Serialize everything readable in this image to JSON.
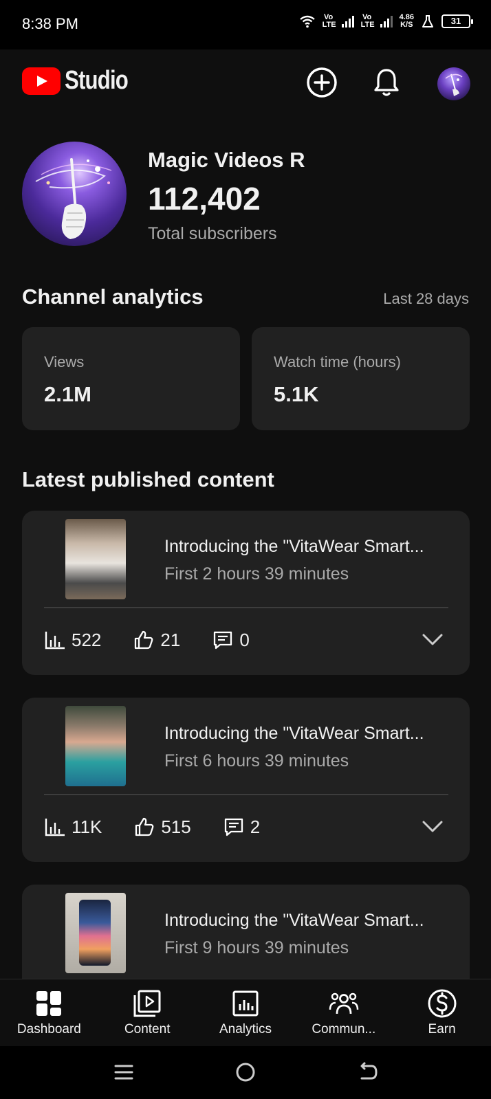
{
  "status_bar": {
    "time": "8:38 PM",
    "sim1_label": "Vo LTE",
    "sim2_label": "Vo LTE",
    "net_speed_value": "4.86",
    "net_speed_unit": "K/S",
    "battery": "31"
  },
  "header": {
    "app_name": "Studio",
    "icons": [
      "youtube-logo-icon",
      "create-plus-icon",
      "notifications-bell-icon",
      "account-avatar"
    ]
  },
  "channel": {
    "name": "Magic Videos R",
    "subscriber_count": "112,402",
    "subscriber_label": "Total subscribers"
  },
  "analytics": {
    "title": "Channel analytics",
    "range": "Last 28 days",
    "cards": [
      {
        "label": "Views",
        "value": "2.1M"
      },
      {
        "label": "Watch time (hours)",
        "value": "5.1K"
      }
    ]
  },
  "latest": {
    "title": "Latest published content",
    "items": [
      {
        "title": "Introducing the \"VitaWear Smart...",
        "subtitle": "First 2 hours 39 minutes",
        "views": "522",
        "likes": "21",
        "comments": "0"
      },
      {
        "title": "Introducing the \"VitaWear Smart...",
        "subtitle": "First 6 hours 39 minutes",
        "views": "11K",
        "likes": "515",
        "comments": "2"
      },
      {
        "title": "Introducing the \"VitaWear Smart...",
        "subtitle": "First 9 hours 39 minutes"
      }
    ]
  },
  "bottom_nav": [
    {
      "label": "Dashboard",
      "icon": "dashboard-icon"
    },
    {
      "label": "Content",
      "icon": "content-icon"
    },
    {
      "label": "Analytics",
      "icon": "analytics-icon"
    },
    {
      "label": "Commun...",
      "icon": "community-icon"
    },
    {
      "label": "Earn",
      "icon": "earn-dollar-icon"
    }
  ],
  "colors": {
    "background": "#0f0f0f",
    "card": "#212121",
    "brand_red": "#ff0000",
    "secondary_text": "#aaaaaa"
  }
}
